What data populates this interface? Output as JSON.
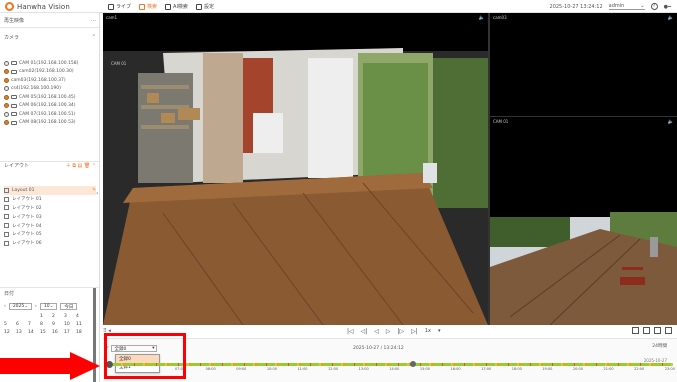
{
  "brand": {
    "name": "Hanwha Vision"
  },
  "nav": [
    {
      "label": "ライブ",
      "icon": "camera-icon"
    },
    {
      "label": "検索",
      "icon": "search-icon",
      "active": true
    },
    {
      "label": "AI検索",
      "icon": "ai-search-icon"
    },
    {
      "label": "設定",
      "icon": "gear-icon"
    }
  ],
  "topright": {
    "datetime": "2025-10-27 13:24:12",
    "user": "admin"
  },
  "sidebar": {
    "menu_title": "再生映像",
    "camera_title": "カメラ",
    "cameras": [
      {
        "label": "CAM 01(192.168.100.158)"
      },
      {
        "label": "cam02(192.168.100.30)"
      },
      {
        "label": "cam03(192.168.100.37)"
      },
      {
        "label": "cs4(192.168.100.190)"
      },
      {
        "label": "CAM 05(192.168.100.45)"
      },
      {
        "label": "CAM 06(192.168.100.34)"
      },
      {
        "label": "CAM 07(192.168.100.51)"
      },
      {
        "label": "CAM 08(192.168.100.53)"
      }
    ],
    "layout_title": "レイアウト",
    "layouts": [
      {
        "label": "Layout 01"
      },
      {
        "label": "レイアウト 01"
      },
      {
        "label": "レイアウト 02"
      },
      {
        "label": "レイアウト 03"
      },
      {
        "label": "レイアウト 04"
      },
      {
        "label": "レイアウト 05"
      },
      {
        "label": "レイアウト 06"
      }
    ],
    "date_title": "日付",
    "calendar": {
      "year": "2025",
      "month": "10",
      "today": "今日",
      "rows": [
        [
          "",
          "",
          "",
          "1",
          "2",
          "3",
          "4"
        ],
        [
          "5",
          "6",
          "7",
          "8",
          "9",
          "10",
          "11"
        ],
        [
          "12",
          "13",
          "14",
          "15",
          "16",
          "17",
          "18"
        ]
      ]
    }
  },
  "video": {
    "tiles": [
      {
        "label": "cam1",
        "cam": "CAM 01"
      },
      {
        "label": "cam03"
      },
      {
        "label": "CAM 01"
      }
    ]
  },
  "controls": {
    "speed": "1x"
  },
  "timeline": {
    "filter_selected": "全録0",
    "filter_options": [
      "全録0",
      "全録1"
    ],
    "datetime": "2025-10-27 / 13:24:12",
    "top_right": "24時間",
    "date_label": "2025-10-27",
    "ticks": [
      "07:00",
      "08:00",
      "09:00",
      "10:00",
      "11:00",
      "12:00",
      "13:00",
      "14:00",
      "15:00",
      "16:00",
      "17:00",
      "18:00",
      "19:00",
      "20:00",
      "21:00",
      "22:00",
      "23:00"
    ]
  }
}
